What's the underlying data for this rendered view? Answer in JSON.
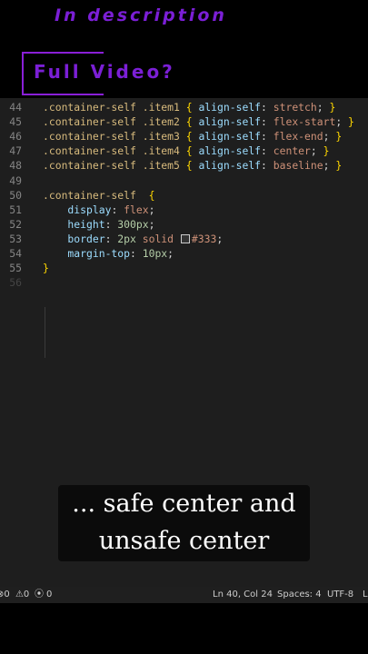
{
  "overlay": {
    "description_text": "In description",
    "full_video_text": "Full Video?"
  },
  "editor": {
    "lines": [
      {
        "num": "44",
        "tokens": [
          {
            "t": ".container-self .item1 ",
            "c": "sel"
          },
          {
            "t": "{ ",
            "c": "brace"
          },
          {
            "t": "align-self",
            "c": "prop"
          },
          {
            "t": ": ",
            "c": "punc"
          },
          {
            "t": "stretch",
            "c": "val"
          },
          {
            "t": "; ",
            "c": "punc"
          },
          {
            "t": "}",
            "c": "brace"
          }
        ]
      },
      {
        "num": "45",
        "tokens": [
          {
            "t": ".container-self .item2 ",
            "c": "sel"
          },
          {
            "t": "{ ",
            "c": "brace"
          },
          {
            "t": "align-self",
            "c": "prop"
          },
          {
            "t": ": ",
            "c": "punc"
          },
          {
            "t": "flex-start",
            "c": "val"
          },
          {
            "t": "; ",
            "c": "punc"
          },
          {
            "t": "}",
            "c": "brace"
          }
        ]
      },
      {
        "num": "46",
        "tokens": [
          {
            "t": ".container-self .item3 ",
            "c": "sel"
          },
          {
            "t": "{ ",
            "c": "brace"
          },
          {
            "t": "align-self",
            "c": "prop"
          },
          {
            "t": ": ",
            "c": "punc"
          },
          {
            "t": "flex-end",
            "c": "val"
          },
          {
            "t": "; ",
            "c": "punc"
          },
          {
            "t": "}",
            "c": "brace"
          }
        ]
      },
      {
        "num": "47",
        "tokens": [
          {
            "t": ".container-self .item4 ",
            "c": "sel"
          },
          {
            "t": "{ ",
            "c": "brace"
          },
          {
            "t": "align-self",
            "c": "prop"
          },
          {
            "t": ": ",
            "c": "punc"
          },
          {
            "t": "center",
            "c": "val"
          },
          {
            "t": "; ",
            "c": "punc"
          },
          {
            "t": "}",
            "c": "brace"
          }
        ]
      },
      {
        "num": "48",
        "tokens": [
          {
            "t": ".container-self .item5 ",
            "c": "sel"
          },
          {
            "t": "{ ",
            "c": "brace"
          },
          {
            "t": "align-self",
            "c": "prop"
          },
          {
            "t": ": ",
            "c": "punc"
          },
          {
            "t": "baseline",
            "c": "val"
          },
          {
            "t": "; ",
            "c": "punc"
          },
          {
            "t": "}",
            "c": "brace"
          }
        ]
      },
      {
        "num": "49",
        "tokens": []
      },
      {
        "num": "50",
        "tokens": [
          {
            "t": ".container-self  ",
            "c": "sel"
          },
          {
            "t": "{",
            "c": "brace"
          }
        ]
      },
      {
        "num": "51",
        "tokens": [
          {
            "t": "    display",
            "c": "prop"
          },
          {
            "t": ": ",
            "c": "punc"
          },
          {
            "t": "flex",
            "c": "val"
          },
          {
            "t": ";",
            "c": "punc"
          }
        ]
      },
      {
        "num": "52",
        "tokens": [
          {
            "t": "    height",
            "c": "prop"
          },
          {
            "t": ": ",
            "c": "punc"
          },
          {
            "t": "300px",
            "c": "num"
          },
          {
            "t": ";",
            "c": "punc"
          }
        ]
      },
      {
        "num": "53",
        "tokens": [
          {
            "t": "    border",
            "c": "prop"
          },
          {
            "t": ": ",
            "c": "punc"
          },
          {
            "t": "2px",
            "c": "num"
          },
          {
            "t": " solid ",
            "c": "val"
          },
          {
            "swatch": "#333333"
          },
          {
            "t": "#333",
            "c": "val"
          },
          {
            "t": ";",
            "c": "punc"
          }
        ]
      },
      {
        "num": "54",
        "tokens": [
          {
            "t": "    margin-top",
            "c": "prop"
          },
          {
            "t": ": ",
            "c": "punc"
          },
          {
            "t": "10px",
            "c": "num"
          },
          {
            "t": ";",
            "c": "punc"
          }
        ]
      },
      {
        "num": "55",
        "tokens": [
          {
            "t": "}",
            "c": "brace"
          }
        ]
      },
      {
        "num": "56",
        "tokens": [],
        "dim": true
      }
    ]
  },
  "caption": {
    "line1": "... safe center and",
    "line2": "unsafe center"
  },
  "statusbar": {
    "errors": "0",
    "warnings": "0",
    "ports": "0",
    "position": "Ln 40, Col 24",
    "spaces": "Spaces: 4",
    "encoding": "UTF-8",
    "eol": "L"
  },
  "colors": {
    "accent_purple": "#7b1fd6",
    "editor_bg": "#1e1e1e",
    "selector": "#d7ba7d",
    "property": "#9cdcfe",
    "value": "#ce9178",
    "number": "#b5cea8",
    "bracket": "#ffd700"
  }
}
